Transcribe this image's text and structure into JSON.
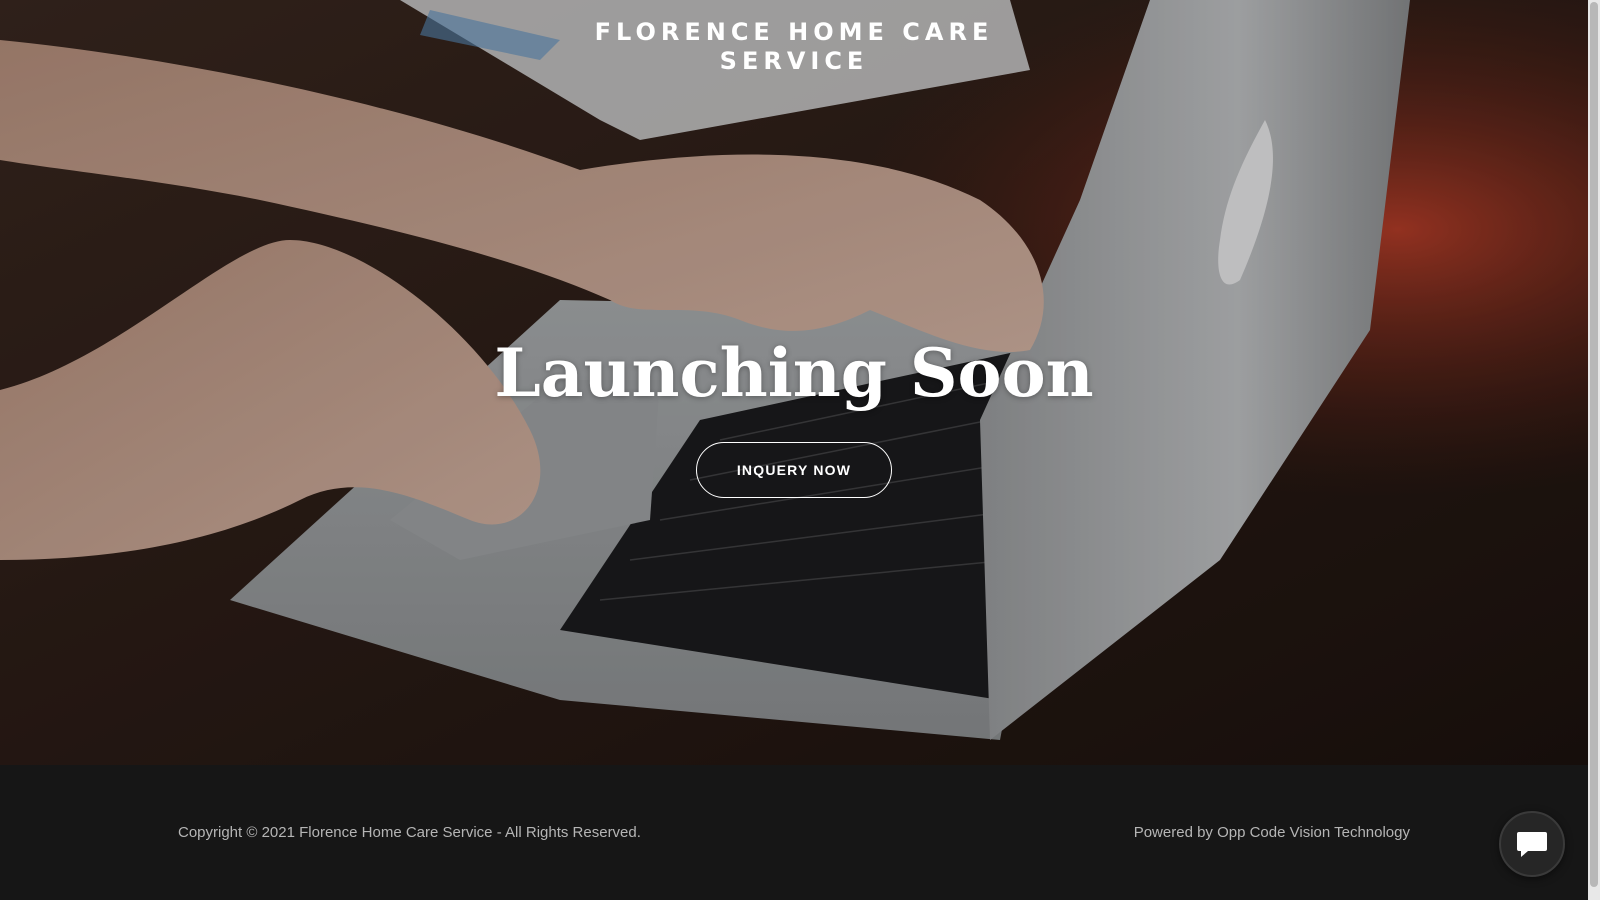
{
  "header": {
    "site_title_line1": "FLORENCE HOME CARE",
    "site_title_line2": "SERVICE"
  },
  "hero": {
    "headline": "Launching Soon",
    "cta_label": "INQUERY NOW",
    "background_description_icon": "laptop-typing-photo"
  },
  "footer": {
    "copyright": "Copyright © 2021 Florence Home Care Service - All Rights Reserved.",
    "powered_by": "Powered by Opp Code Vision Technology"
  },
  "chat": {
    "icon": "chat-bubble-icon"
  },
  "colors": {
    "footer_bg": "#161616",
    "footer_text": "#b5b5b5",
    "hero_text": "#ffffff"
  }
}
